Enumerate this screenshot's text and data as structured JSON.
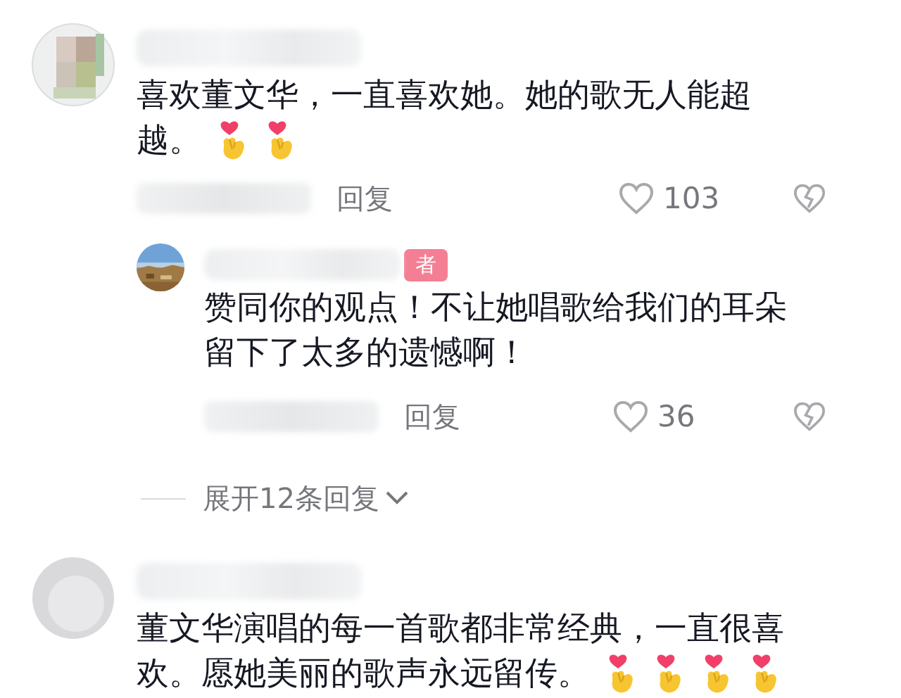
{
  "comments": [
    {
      "avatar": {
        "kind": "mosaic"
      },
      "text_lines": [
        "喜欢董文华，一直喜欢她。她的歌无人能超",
        "越。"
      ],
      "emojis": [
        {
          "kind": "finger-heart"
        },
        {
          "kind": "finger-heart"
        }
      ],
      "reply_label": "回复",
      "likes": "103",
      "replies": [
        {
          "avatar": {
            "kind": "landscape"
          },
          "badge": "者",
          "text_lines": [
            "赞同你的观点！不让她唱歌给我们的耳朵",
            "留下了太多的遗憾啊！"
          ],
          "reply_label": "回复",
          "likes": "36"
        }
      ],
      "expand": "展开12条回复"
    },
    {
      "avatar": {
        "kind": "blank"
      },
      "text_lines": [
        "董文华演唱的每一首歌都非常经典，一直很喜",
        "欢。愿她美丽的歌声永远留传。"
      ],
      "emojis": [
        {
          "kind": "finger-heart"
        },
        {
          "kind": "finger-heart"
        },
        {
          "kind": "finger-heart"
        },
        {
          "kind": "finger-heart"
        }
      ]
    }
  ]
}
